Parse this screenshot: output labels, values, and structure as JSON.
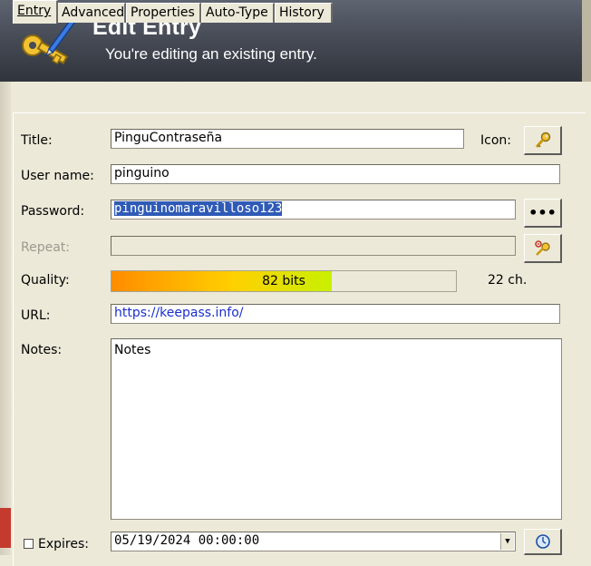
{
  "window": {
    "title": "Edit Entry",
    "subtitle": "You're editing an existing entry."
  },
  "tabs": [
    {
      "label": "Entry",
      "active": true
    },
    {
      "label": "Advanced",
      "active": false
    },
    {
      "label": "Properties",
      "active": false
    },
    {
      "label": "Auto-Type",
      "active": false
    },
    {
      "label": "History",
      "active": false
    }
  ],
  "form": {
    "title_label": "Title:",
    "title_value": "PinguContraseña",
    "icon_label": "Icon:",
    "username_label": "User name:",
    "username_value": "pinguino",
    "password_label": "Password:",
    "password_value": "pinguinomaravilloso123",
    "password_toggle_label": "•••",
    "repeat_label": "Repeat:",
    "repeat_value": "",
    "quality_label": "Quality:",
    "quality_text": "82 bits",
    "quality_fraction": 0.64,
    "length_text": "22 ch.",
    "url_label": "URL:",
    "url_value": "https://keepass.info/",
    "notes_label": "Notes:",
    "notes_value": "Notes",
    "expires_label": "Expires:",
    "expires_checked": false,
    "expires_value": "05/19/2024 00:00:00"
  },
  "icons": {
    "banner": "keys-pen-icon",
    "entry_icon": "key-icon",
    "password_generator": "key-gear-icon",
    "expiry_picker": "clock-icon"
  },
  "colors": {
    "banner_bg": "#474c57",
    "selection": "#2f5bb7",
    "url_text": "#1a2fd0",
    "quality_start": "#ff8c00",
    "quality_end": "#c8f000"
  }
}
